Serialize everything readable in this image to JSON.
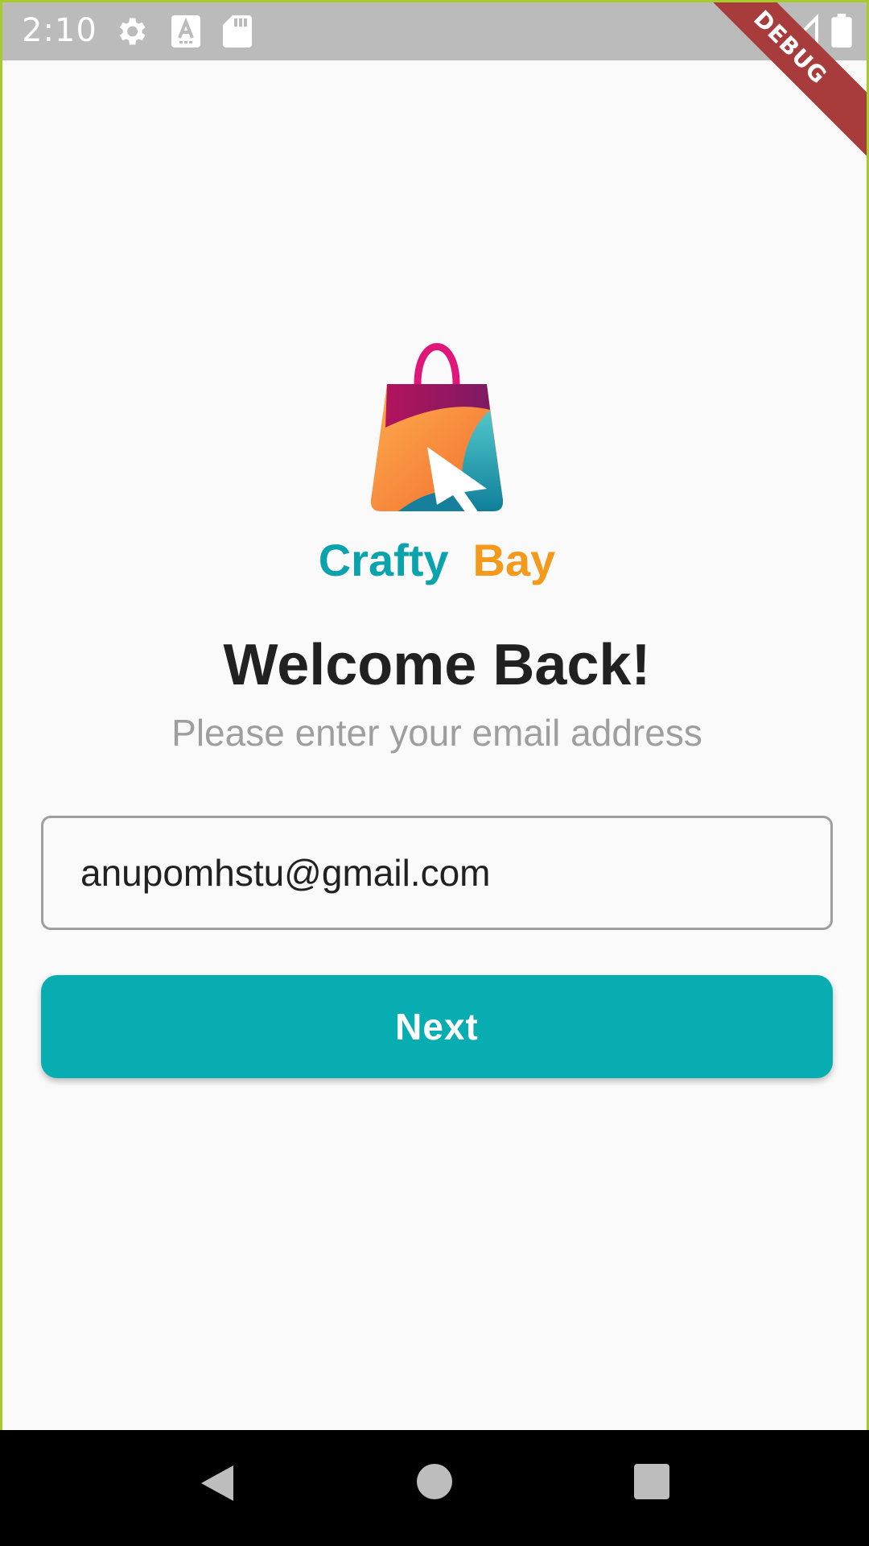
{
  "status_bar": {
    "time": "2:10",
    "icons": [
      "gear-icon",
      "a-icon",
      "sd-card-icon",
      "wifi-icon",
      "signal-icon",
      "battery-icon"
    ],
    "debug_label": "DEBUG"
  },
  "brand": {
    "logo": "shopping-bag-cursor-logo",
    "name_part1": "Crafty",
    "name_part2": "Bay",
    "color_part1": "#0aa3ad",
    "color_part2": "#f4991a"
  },
  "welcome": {
    "title": "Welcome Back!",
    "subtitle": "Please enter your email address"
  },
  "form": {
    "email_value": "anupomhstu@gmail.com",
    "next_label": "Next",
    "accent_color": "#07adb0"
  },
  "nav_bar": {
    "icons": [
      "back-icon",
      "home-icon",
      "recents-icon"
    ]
  }
}
